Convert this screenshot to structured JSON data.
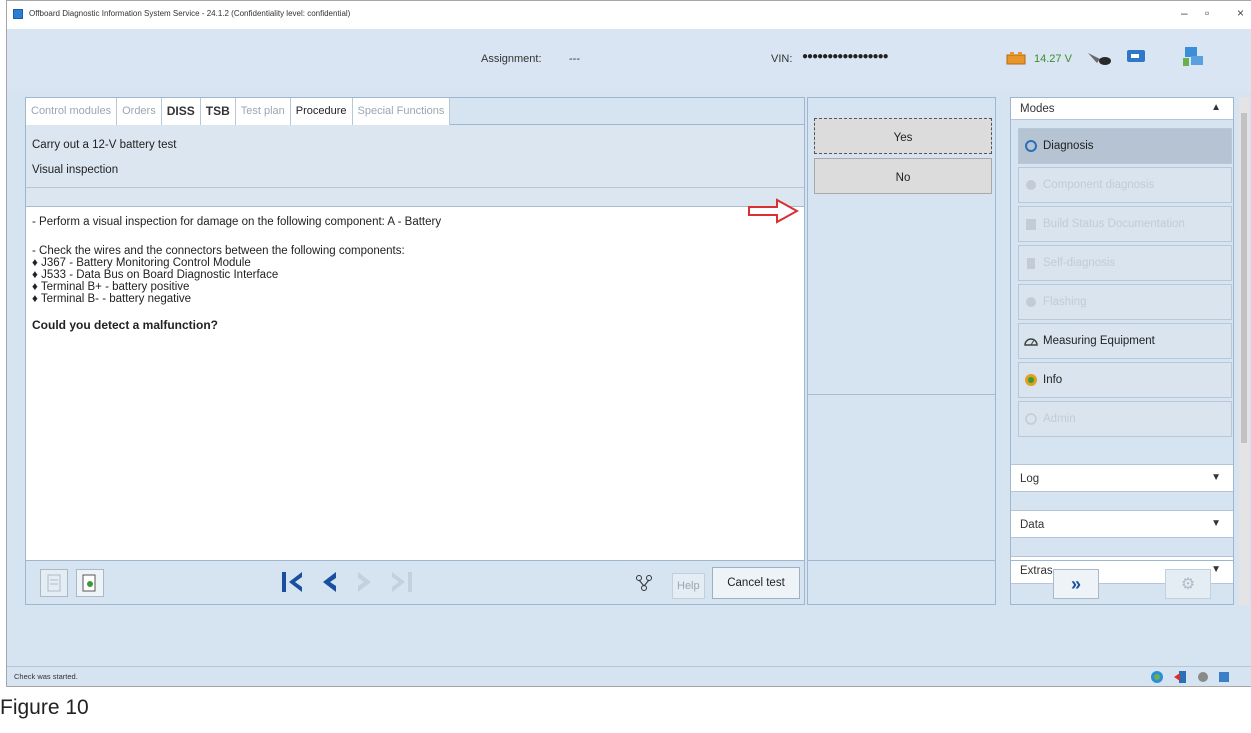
{
  "window": {
    "title": "Offboard Diagnostic Information System Service - 24.1.2 (Confidentiality level: confidential)",
    "minimize_label": "–",
    "maximize_label": "▫",
    "close_label": "×"
  },
  "header": {
    "assignment_label": "Assignment:",
    "assignment_value": "---",
    "vin_label": "VIN:",
    "vin_value": "●●●●●●●●●●●●●●●●●",
    "voltage": "14.27 V"
  },
  "tabs": [
    {
      "label": "Control modules"
    },
    {
      "label": "Orders"
    },
    {
      "label": "DISS"
    },
    {
      "label": "TSB"
    },
    {
      "label": "Test plan"
    },
    {
      "label": "Procedure"
    },
    {
      "label": "Special Functions"
    }
  ],
  "procedure": {
    "title": "Carry out a 12-V battery test",
    "subtitle": "Visual inspection",
    "line1": "- Perform a visual inspection for damage on the following component: A - Battery",
    "line2": "- Check the wires and the connectors between the following components:",
    "bullets": [
      "♦ J367 - Battery Monitoring Control Module",
      "♦ J533 - Data Bus on Board Diagnostic Interface",
      "♦ Terminal B+ - battery positive",
      "♦ Terminal B- - battery negative"
    ],
    "question": "Could you detect a malfunction?"
  },
  "answers": {
    "yes": "Yes",
    "no": "No"
  },
  "bottom_bar": {
    "help": "Help",
    "cancel": "Cancel test"
  },
  "sidebar": {
    "modes_label": "Modes",
    "modes": [
      {
        "label": "Diagnosis"
      },
      {
        "label": "Component diagnosis"
      },
      {
        "label": "Build Status Documentation"
      },
      {
        "label": "Self-diagnosis"
      },
      {
        "label": "Flashing"
      },
      {
        "label": "Measuring Equipment"
      },
      {
        "label": "Info"
      },
      {
        "label": "Admin"
      }
    ],
    "sections": [
      {
        "label": "Log"
      },
      {
        "label": "Data"
      },
      {
        "label": "Extras"
      }
    ]
  },
  "status": {
    "text": "Check was started."
  },
  "caption": "Figure 10",
  "colors": {
    "accent": "#1a4fa0",
    "arrow": "#d93030",
    "panel": "#d6e3f0"
  }
}
